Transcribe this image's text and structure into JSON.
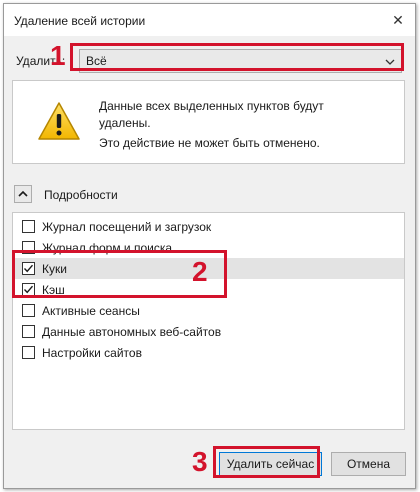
{
  "window": {
    "title": "Удаление всей истории",
    "close_glyph": "✕"
  },
  "clear": {
    "label": "Удалить:",
    "selected": "Всё"
  },
  "warning": {
    "icon": "warning-triangle-icon",
    "line1": "Данные всех выделенных пунктов будут удалены.",
    "line2": "Это действие не может быть отменено."
  },
  "details": {
    "label": "Подробности",
    "expanded": true
  },
  "items": [
    {
      "label": "Журнал посещений и загрузок",
      "checked": false
    },
    {
      "label": "Журнал форм и поиска",
      "checked": false
    },
    {
      "label": "Куки",
      "checked": true
    },
    {
      "label": "Кэш",
      "checked": true
    },
    {
      "label": "Активные сеансы",
      "checked": false
    },
    {
      "label": "Данные автономных веб-сайтов",
      "checked": false
    },
    {
      "label": "Настройки сайтов",
      "checked": false
    }
  ],
  "buttons": {
    "delete": "Удалить сейчас",
    "cancel": "Отмена"
  },
  "annotations": {
    "one": "1",
    "two": "2",
    "three": "3"
  },
  "colors": {
    "annotation": "#d3132c",
    "dialog_bg": "#f0f0f0",
    "focus_blue": "#0078d7"
  }
}
